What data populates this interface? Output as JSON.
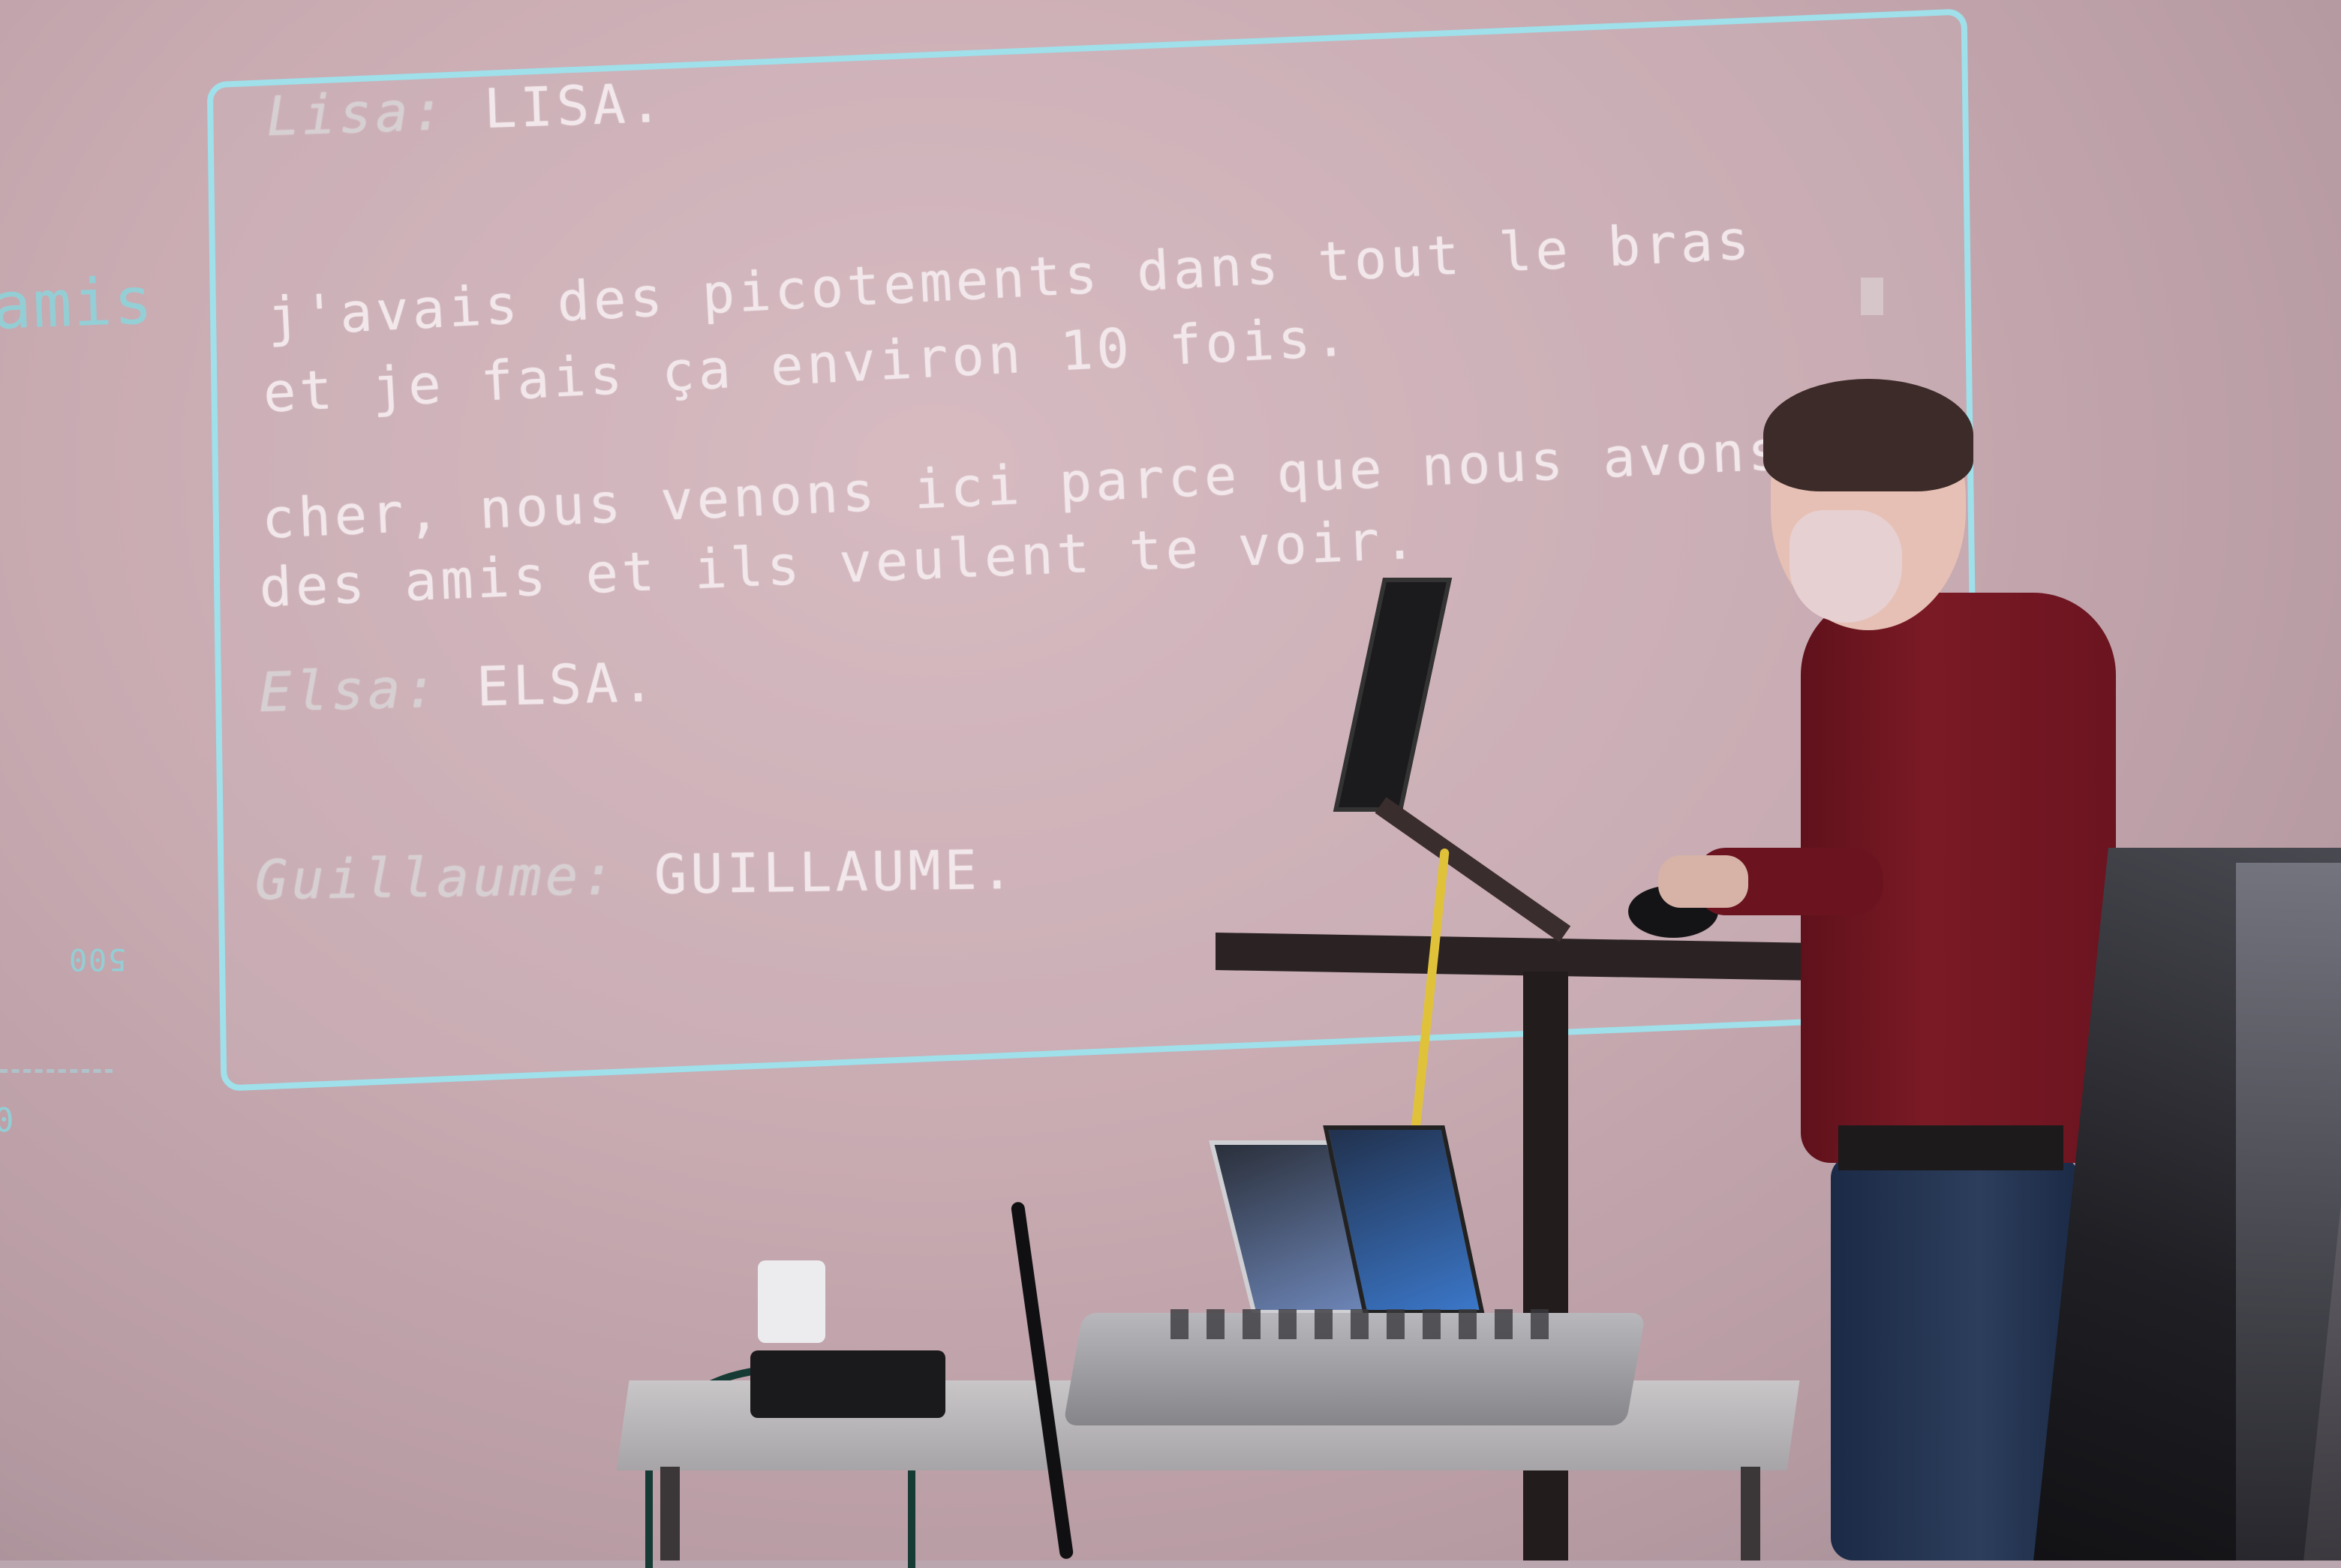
{
  "projection": {
    "left_fragments": {
      "amis": "amis",
      "number": "500",
      "zero": "0"
    },
    "lines": [
      {
        "speaker": "Lisa:",
        "text": "LISA."
      },
      {
        "speaker": "",
        "text": "j'avais des picotements dans tout le bras"
      },
      {
        "speaker": "",
        "text": "et je fais ça environ 10 fois."
      },
      {
        "speaker": "",
        "text": "cher, nous venons ici parce que nous avons"
      },
      {
        "speaker": "",
        "text": "des amis et ils veulent te voir."
      },
      {
        "speaker": "Elsa:",
        "text": "ELSA."
      },
      {
        "speaker": "Guillaume:",
        "text": "GUILLAUME."
      }
    ]
  },
  "colors": {
    "terminal_border": "#9fe0ea",
    "terminal_text": "#f2e7ea",
    "sweater": "#6b1420"
  },
  "icons": {
    "person": "person-figure",
    "laptop": "laptop-icon",
    "mixer": "audio-mixer-icon"
  }
}
